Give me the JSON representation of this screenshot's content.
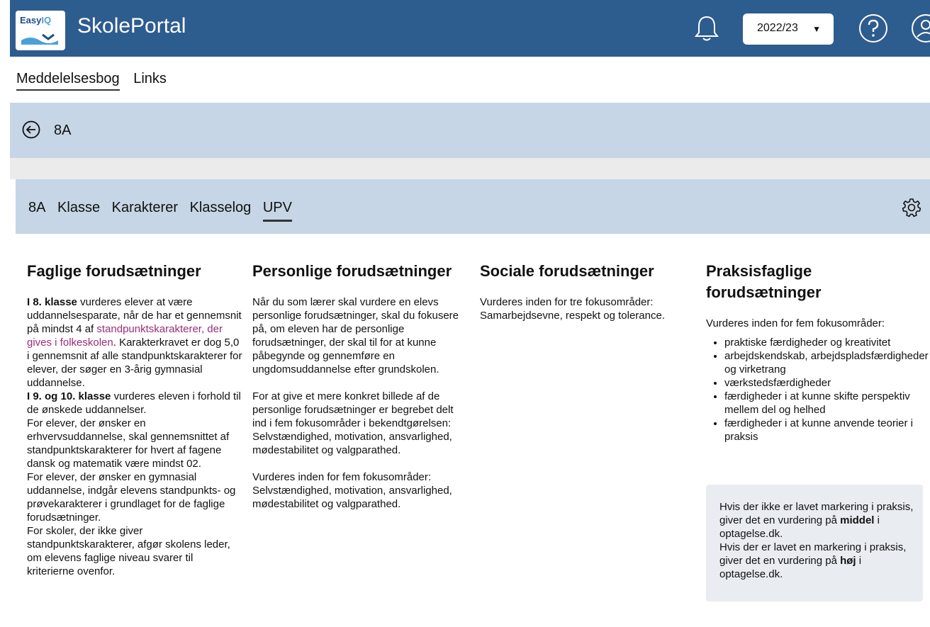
{
  "header": {
    "logo_text_a": "Easy",
    "logo_text_b": "IQ",
    "app_title": "SkolePortal",
    "year_selected": "2022/23",
    "year_caret": "▼"
  },
  "nav": {
    "items": [
      {
        "label": "Meddelelsesbog",
        "active": true
      },
      {
        "label": "Links",
        "active": false
      }
    ]
  },
  "class_header": {
    "name": "8A"
  },
  "tabs": [
    {
      "label": "8A"
    },
    {
      "label": "Klasse"
    },
    {
      "label": "Karakterer"
    },
    {
      "label": "Klasselog"
    },
    {
      "label": "UPV",
      "active": true
    }
  ],
  "columns": {
    "faglige": {
      "title": "Faglige forudsætninger",
      "p1_bold": "I 8. klasse",
      "p1_text": " vurderes elever at være uddannelsesparate, når de har et gennemsnit på mindst 4 af ",
      "p1_link": "standpunktskarakterer, der gives i folkeskolen",
      "p1_rest": ". Karakterkravet er dog 5,0 i gennemsnit af alle standpunktskarakterer for elever, der søger en 3-årig gymnasial uddannelse.",
      "p2_bold": "I 9. og 10. klasse",
      "p2_text": " vurderes eleven i forhold til de ønskede uddannelser.",
      "p3": "For elever, der ønsker en erhvervsuddannelse, skal gennemsnittet af standpunktskarakterer for hvert af fagene dansk og matematik være mindst 02.",
      "p4": "For elever, der ønsker en gymnasial uddannelse, indgår elevens standpunkts- og prøvekarakterer i grundlaget for de faglige forudsætninger.",
      "p5": "For skoler, der ikke giver standpunktskarakterer, afgør skolens leder, om elevens faglige niveau svarer til kriterierne ovenfor."
    },
    "personlige": {
      "title": "Personlige forudsætninger",
      "p1": "Når du som lærer skal vurdere en elevs personlige forudsætninger, skal du fokusere på, om eleven har de personlige forudsætninger, der skal til for at kunne påbegynde og gennemføre en ungdomsuddannelse efter grundskolen.",
      "p2": "For at give et mere konkret billede af de personlige forudsætninger er begrebet delt ind i fem fokusområder i bekendtgørelsen: Selvstændighed, motivation, ansvarlighed, mødestabilitet og valgparathed.",
      "p3": "Vurderes inden for fem fokusområder: Selvstændighed, motivation, ansvarlighed, mødestabilitet og valgparathed."
    },
    "sociale": {
      "title": "Sociale forudsætninger",
      "p1": "Vurderes inden for tre fokusområder: Samarbejdsevne, respekt og tolerance."
    },
    "praksis": {
      "title": "Praksisfaglige forudsætninger",
      "intro": "Vurderes inden for fem fokusområder:",
      "items": [
        "praktiske færdigheder og kreativitet",
        "arbejdskendskab, arbejdspladsfærdigheder og virketrang",
        "værkstedsfærdigheder",
        "færdigheder i at kunne skifte perspektiv mellem del og helhed",
        "færdigheder i at kunne anvende teorier i praksis"
      ],
      "note": {
        "a1": "Hvis der ikke er lavet markering i praksis, giver det en vurdering på ",
        "a_bold": "middel",
        "a2": " i optagelse.dk.",
        "b1": "Hvis der er lavet en markering i praksis, giver det en vurdering på ",
        "b_bold": "høj",
        "b2": " i optagelse.dk."
      }
    }
  },
  "icons": [
    "bell-icon",
    "help-icon",
    "user-icon",
    "back-arrow-icon",
    "gear-icon"
  ],
  "colors": {
    "topbar": "#2d5c8f",
    "panel": "#c6d6e6",
    "link": "#9b2c7a"
  }
}
